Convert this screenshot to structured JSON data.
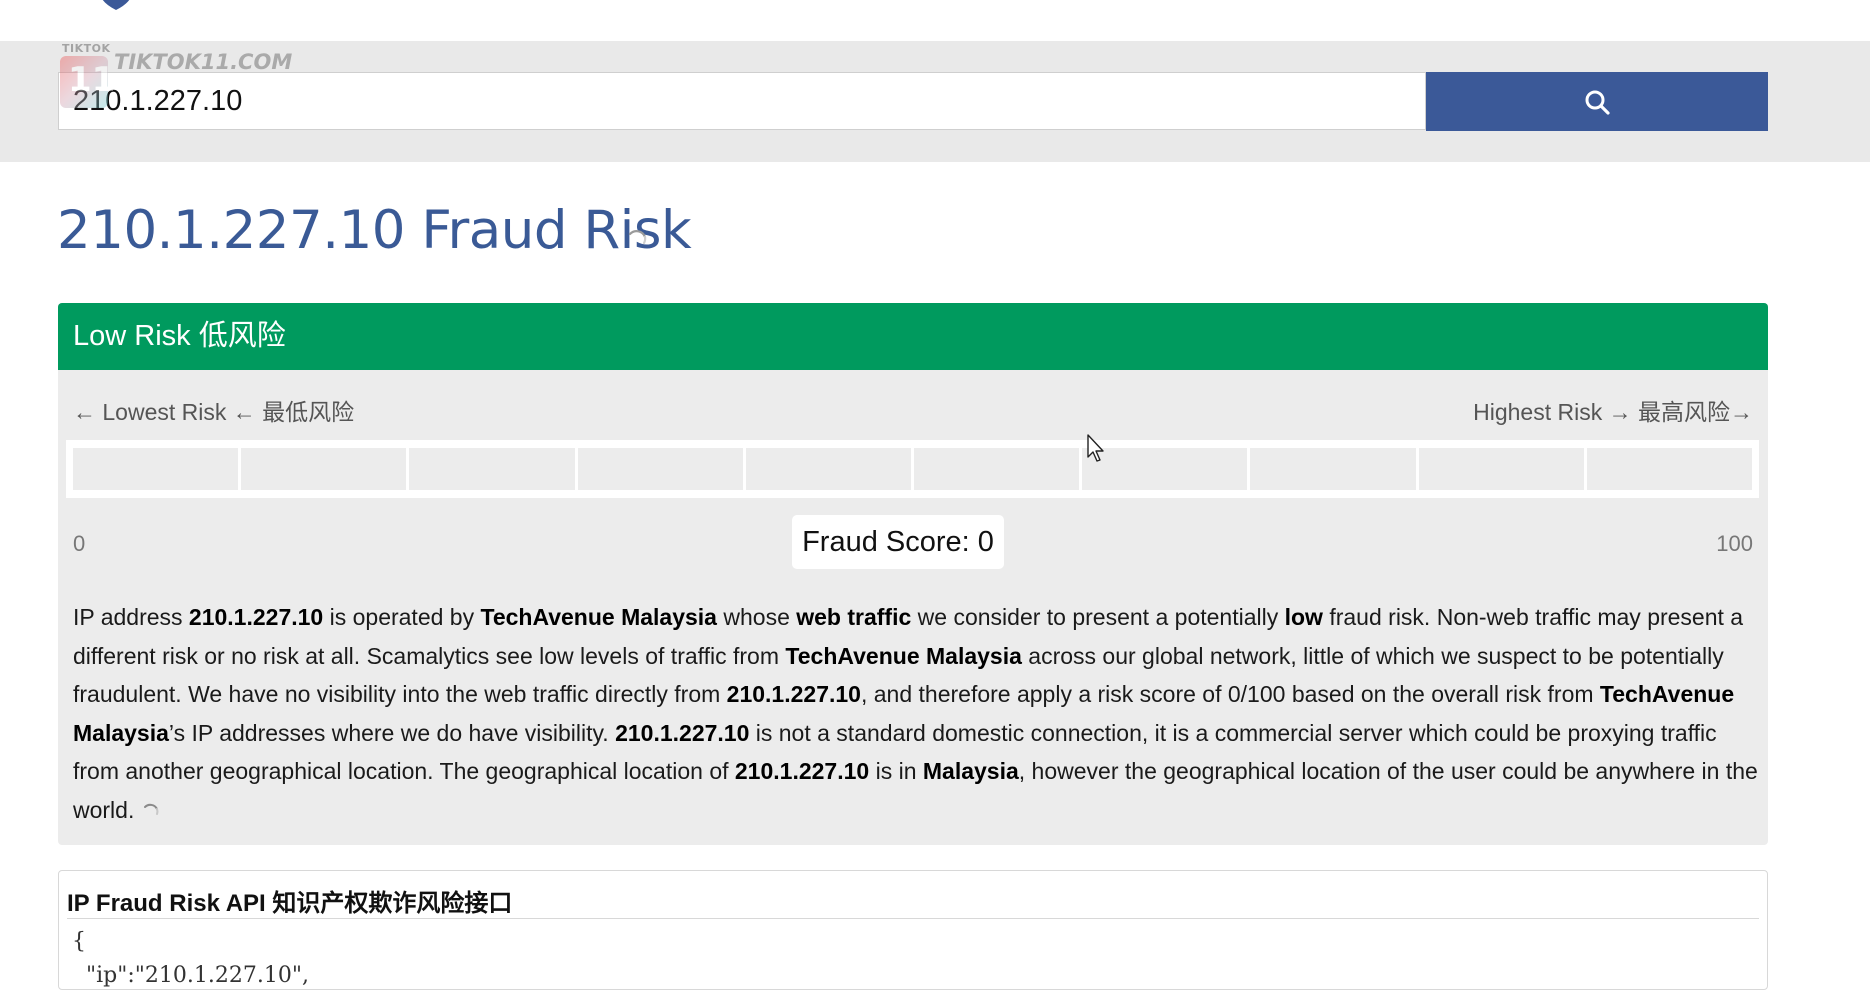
{
  "watermark": {
    "small": "TIKTOK",
    "big": "TIKTOK11.COM",
    "badge": "11"
  },
  "search": {
    "value": "210.1.227.10",
    "button_icon": "search-icon"
  },
  "page": {
    "title": "210.1.227.10 Fraud Risk"
  },
  "risk": {
    "header": "Low Risk 低风险",
    "lowest_label": "← Lowest Risk ← 最低风险",
    "highest_label": "Highest Risk → 最高风险→",
    "scale_min": "0",
    "scale_max": "100",
    "score_label": "Fraud Score: 0",
    "score_value": 0,
    "segments": 10,
    "header_color": "#009a5e"
  },
  "description": {
    "p1": "IP address ",
    "ip1": "210.1.227.10",
    "p2": " is operated by ",
    "org1": "TechAvenue Malaysia",
    "p3": " whose ",
    "web": "web traffic",
    "p4": " we consider to present a potentially ",
    "low": "low",
    "p5": " fraud risk. Non-web traffic may present a different risk or no risk at all. Scamalytics see low levels of traffic from ",
    "org2": "TechAvenue Malaysia",
    "p6": " across our global network, little of which we suspect to be potentially fraudulent. We have no visibility into the web traffic directly from ",
    "ip2": "210.1.227.10",
    "p7": ", and therefore apply a risk score of 0/100 based on the overall risk from ",
    "org3": "TechAvenue Malaysia",
    "p8": "’s IP addresses where we do have visibility. ",
    "ip3": "210.1.227.10",
    "p9": " is not a standard domestic connection, it is a commercial server which could be proxying traffic from another geographical location. The geographical location of ",
    "ip4": "210.1.227.10",
    "p10": " is in ",
    "country": "Malaysia",
    "p11": ", however the geographical location of the user could be anywhere in the world."
  },
  "api": {
    "title": "IP Fraud Risk API 知识产权欺诈风险接口",
    "code_line1": "{",
    "code_line2": "  \"ip\":\"210.1.227.10\","
  },
  "colors": {
    "brand_blue": "#3b5998",
    "title_blue": "#3a5a96",
    "low_risk_green": "#009a5e"
  }
}
